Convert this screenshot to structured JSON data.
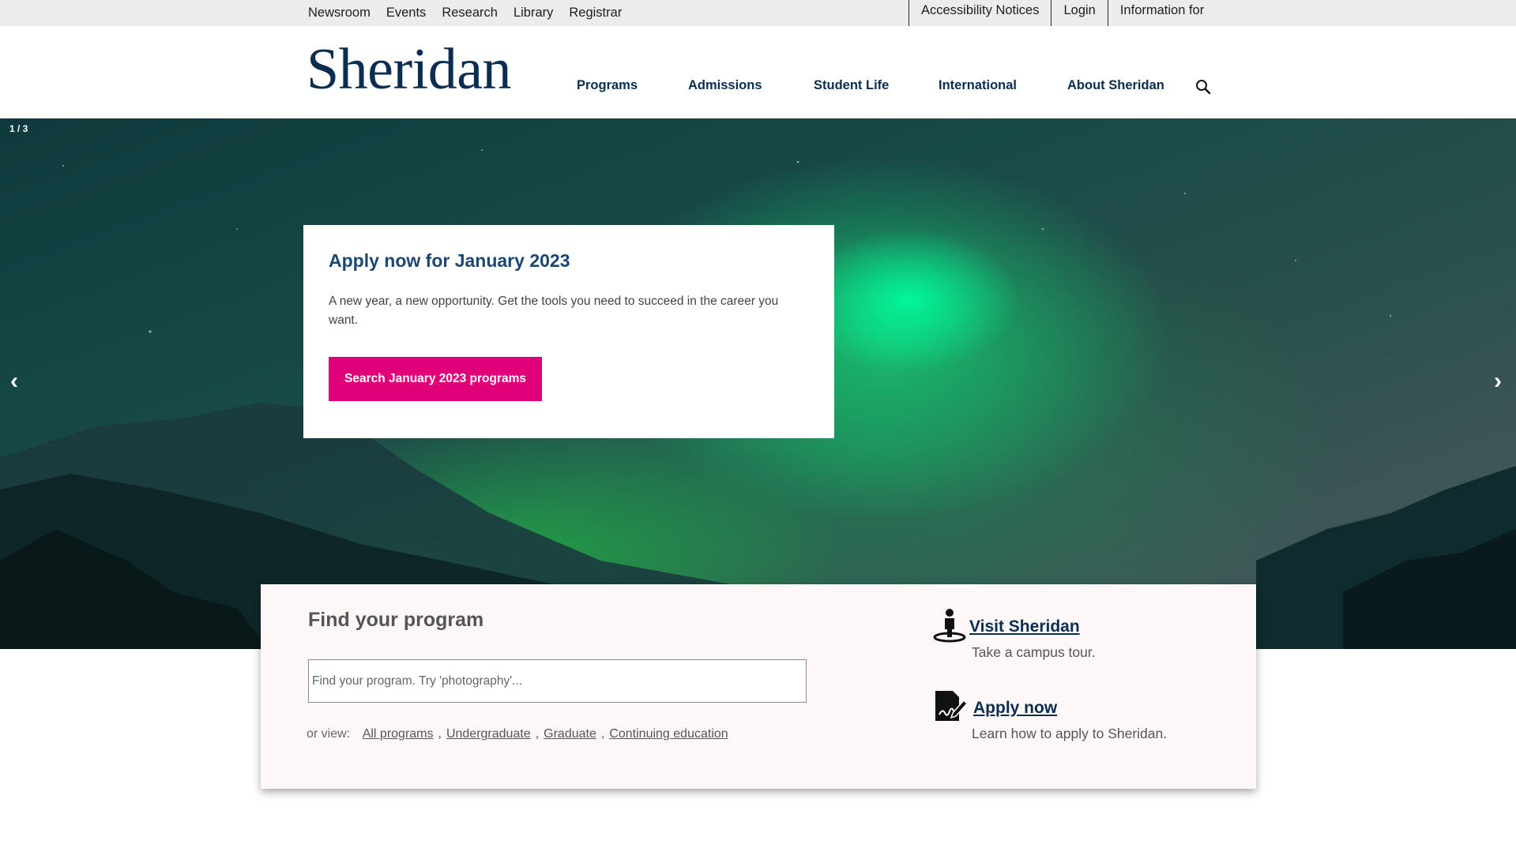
{
  "utility_nav": {
    "left": [
      "Newsroom",
      "Events",
      "Research",
      "Library",
      "Registrar"
    ],
    "right": [
      "Accessibility Notices",
      "Login",
      "Information for"
    ]
  },
  "header": {
    "logo": "Sheridan",
    "nav": [
      "Programs",
      "Admissions",
      "Student Life",
      "International",
      "About Sheridan"
    ],
    "search_icon": "search-icon"
  },
  "hero": {
    "counter": "1 / 3",
    "prev": "‹",
    "next": "›",
    "title": "Apply now for January 2023",
    "text": "A new year, a new opportunity. Get the tools you need to succeed in the career you want.",
    "cta": "Search January 2023 programs",
    "cta_color": "#e0007a"
  },
  "finder": {
    "title": "Find your program",
    "placeholder": "Find your program. Try 'photography'...",
    "or_view": "or view:",
    "links": [
      "All programs",
      "Undergraduate",
      "Graduate",
      "Continuing education"
    ],
    "separator": ","
  },
  "quick_links": [
    {
      "label": "Visit Sheridan",
      "desc": "Take a campus tour.",
      "icon": "person-location-icon"
    },
    {
      "label": "Apply now",
      "desc": "Learn how to apply to Sheridan.",
      "icon": "signature-icon"
    }
  ],
  "colors": {
    "brand_navy": "#0b2d4f",
    "accent_magenta": "#e0007a",
    "title_blue": "#1c4770"
  }
}
